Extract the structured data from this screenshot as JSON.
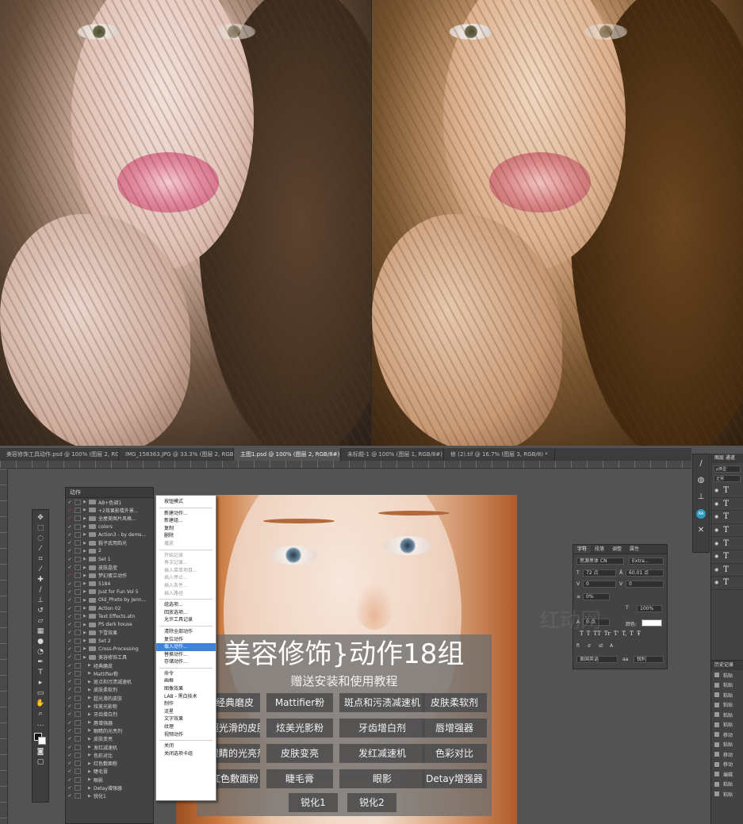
{
  "tabs": [
    {
      "label": "美容修饰工具动作.psd @ 100% (图层 2, RGB/8#) *",
      "active": false
    },
    {
      "label": "IMG_158363.JPG @ 33.3% (图层 2, RGB/8) *",
      "active": false
    },
    {
      "label": "主图1.psd @ 100% (图层 2, RGB/8#) *",
      "active": true
    },
    {
      "label": "未标题-1 @ 100% (图层 1, RGB/8#) *",
      "active": false
    },
    {
      "label": "修 (2).tif @ 16.7% (图层 3, RGB/8) *",
      "active": false
    }
  ],
  "actions_panel": {
    "title": "动作",
    "rows": [
      {
        "label": "AB+色调1",
        "checked": true,
        "red": false,
        "indent": false,
        "folder": true
      },
      {
        "label": "+2效果影楼外景...",
        "checked": true,
        "red": true,
        "indent": false,
        "folder": true
      },
      {
        "label": "全屋美图片风格...",
        "checked": true,
        "red": true,
        "indent": false,
        "folder": true
      },
      {
        "label": "colors",
        "checked": true,
        "red": false,
        "indent": false,
        "folder": true
      },
      {
        "label": "Action3 - by dems...",
        "checked": true,
        "red": false,
        "indent": false,
        "folder": true
      },
      {
        "label": "鞋子武用韵光",
        "checked": true,
        "red": false,
        "indent": false,
        "folder": true
      },
      {
        "label": "2",
        "checked": true,
        "red": false,
        "indent": false,
        "folder": true
      },
      {
        "label": "Set 1",
        "checked": true,
        "red": false,
        "indent": false,
        "folder": true
      },
      {
        "label": "皮肤晶莹",
        "checked": true,
        "red": false,
        "indent": false,
        "folder": true
      },
      {
        "label": "梦幻蛋立动作",
        "checked": true,
        "red": true,
        "indent": false,
        "folder": true
      },
      {
        "label": "5184",
        "checked": true,
        "red": false,
        "indent": false,
        "folder": true
      },
      {
        "label": "Just for Fun Vol 5",
        "checked": true,
        "red": false,
        "indent": false,
        "folder": true
      },
      {
        "label": "Old_Photo by Jenn...",
        "checked": true,
        "red": false,
        "indent": false,
        "folder": true
      },
      {
        "label": "Action 02",
        "checked": true,
        "red": false,
        "indent": false,
        "folder": true
      },
      {
        "label": "Text Effects.atn",
        "checked": true,
        "red": false,
        "indent": false,
        "folder": true
      },
      {
        "label": "PS dark house",
        "checked": true,
        "red": false,
        "indent": false,
        "folder": true
      },
      {
        "label": "下雪效果",
        "checked": true,
        "red": false,
        "indent": false,
        "folder": true
      },
      {
        "label": "Set 2",
        "checked": true,
        "red": false,
        "indent": false,
        "folder": true
      },
      {
        "label": "Cross-Processing",
        "checked": true,
        "red": false,
        "indent": false,
        "folder": true
      },
      {
        "label": "美容修饰工具",
        "checked": true,
        "red": false,
        "indent": false,
        "folder": true
      },
      {
        "label": "经典磨皮",
        "checked": true,
        "red": false,
        "indent": true,
        "folder": false
      },
      {
        "label": "Mattifier粉",
        "checked": true,
        "red": false,
        "indent": true,
        "folder": false
      },
      {
        "label": "斑点和污渍减速机",
        "checked": true,
        "red": false,
        "indent": true,
        "folder": false
      },
      {
        "label": "皮肤柔软剂",
        "checked": true,
        "red": false,
        "indent": true,
        "folder": false
      },
      {
        "label": "超光滑的皮肤",
        "checked": true,
        "red": false,
        "indent": true,
        "folder": false
      },
      {
        "label": "炫美光影粉",
        "checked": true,
        "red": false,
        "indent": true,
        "folder": false
      },
      {
        "label": "牙齿增白剂",
        "checked": true,
        "red": false,
        "indent": true,
        "folder": false
      },
      {
        "label": "唇增强器",
        "checked": true,
        "red": false,
        "indent": true,
        "folder": false
      },
      {
        "label": "眼睛的光亮剂",
        "checked": true,
        "red": false,
        "indent": true,
        "folder": false
      },
      {
        "label": "皮肤变亮",
        "checked": true,
        "red": false,
        "indent": true,
        "folder": false
      },
      {
        "label": "发红减速机",
        "checked": true,
        "red": false,
        "indent": true,
        "folder": false
      },
      {
        "label": "色彩对比",
        "checked": true,
        "red": false,
        "indent": true,
        "folder": false
      },
      {
        "label": "红色敷面粉",
        "checked": true,
        "red": false,
        "indent": true,
        "folder": false
      },
      {
        "label": "睫毛膏",
        "checked": true,
        "red": false,
        "indent": true,
        "folder": false
      },
      {
        "label": "眼影",
        "checked": true,
        "red": false,
        "indent": true,
        "folder": false
      },
      {
        "label": "Detay增强器",
        "checked": true,
        "red": false,
        "indent": true,
        "folder": false
      },
      {
        "label": "锐化1",
        "checked": true,
        "red": false,
        "indent": true,
        "folder": false
      }
    ]
  },
  "menu": {
    "items": [
      {
        "label": "按钮模式",
        "type": "item"
      },
      {
        "type": "sep"
      },
      {
        "label": "新建动作...",
        "type": "item"
      },
      {
        "label": "新建组...",
        "type": "item"
      },
      {
        "label": "复制",
        "type": "item"
      },
      {
        "label": "删除",
        "type": "item"
      },
      {
        "label": "播放",
        "type": "disabled"
      },
      {
        "type": "sep"
      },
      {
        "label": "开始记录",
        "type": "disabled"
      },
      {
        "label": "再次记录...",
        "type": "disabled"
      },
      {
        "label": "插入菜单项目...",
        "type": "disabled"
      },
      {
        "label": "插入停止...",
        "type": "disabled"
      },
      {
        "label": "插入条件...",
        "type": "disabled"
      },
      {
        "label": "插入路径",
        "type": "disabled"
      },
      {
        "type": "sep"
      },
      {
        "label": "组选项...",
        "type": "item"
      },
      {
        "label": "回放选项...",
        "type": "item"
      },
      {
        "label": "允许工具记录",
        "type": "item"
      },
      {
        "type": "sep"
      },
      {
        "label": "清除全部动作",
        "type": "item"
      },
      {
        "label": "复位动作",
        "type": "item"
      },
      {
        "label": "载入动作...",
        "type": "hl"
      },
      {
        "label": "替换动作...",
        "type": "item"
      },
      {
        "label": "存储动作...",
        "type": "item"
      },
      {
        "type": "sep"
      },
      {
        "label": "命令",
        "type": "item"
      },
      {
        "label": "画框",
        "type": "item"
      },
      {
        "label": "图像效果",
        "type": "item"
      },
      {
        "label": "LAB - 黑白技术",
        "type": "item"
      },
      {
        "label": "制作",
        "type": "item"
      },
      {
        "label": "流星",
        "type": "item"
      },
      {
        "label": "文字效果",
        "type": "item"
      },
      {
        "label": "纹理",
        "type": "item"
      },
      {
        "label": "视频动作",
        "type": "item"
      },
      {
        "type": "sep"
      },
      {
        "label": "关闭",
        "type": "item"
      },
      {
        "label": "关闭选项卡组",
        "type": "item"
      }
    ]
  },
  "promo": {
    "title": "美容修饰}动作18组",
    "subtitle": "赠送安装和使用教程",
    "buttons": [
      "经典磨皮",
      "Mattifier粉",
      "斑点和污渍减速机",
      "皮肤柔软剂",
      "超光滑的皮肤",
      "炫美光影粉",
      "牙齿增白剂",
      "唇增强器",
      "眼睛的光亮剂",
      "皮肤变亮",
      "发红减速机",
      "色彩对比",
      "红色敷面粉",
      "睫毛膏",
      "眼影",
      "Detay增强器",
      "锐化1",
      "锐化2"
    ]
  },
  "char_panel": {
    "tabs": [
      "字符",
      "段落",
      "调整",
      "属性"
    ],
    "font_family": "思源黑体 CN",
    "font_style": "Extra...",
    "size": "72 点",
    "leading": "60.01 点",
    "tracking": "0",
    "kerning": "0",
    "vscale": "0%",
    "hscale": "100%",
    "baseline": "0 点",
    "color_label": "颜色:",
    "language": "美国英语",
    "antialias": "锐利",
    "style_buttons": [
      "T",
      "T",
      "TT",
      "Tr",
      "T'",
      "T,",
      "T",
      "Ŧ"
    ]
  },
  "layers_panel": {
    "tabs": "图层 通道",
    "filter": "ρ类型",
    "mode": "正常",
    "rows": [
      "T",
      "T",
      "T",
      "T",
      "T",
      "T",
      "T",
      "T"
    ]
  },
  "history_panel": {
    "title": "历史记录",
    "rows": [
      "粘贴",
      "粘贴",
      "粘贴",
      "粘贴",
      "粘贴",
      "粘贴",
      "移动",
      "粘贴",
      "移动",
      "移动",
      "编辑",
      "粘贴",
      "粘贴"
    ]
  },
  "watermark": "红动网"
}
